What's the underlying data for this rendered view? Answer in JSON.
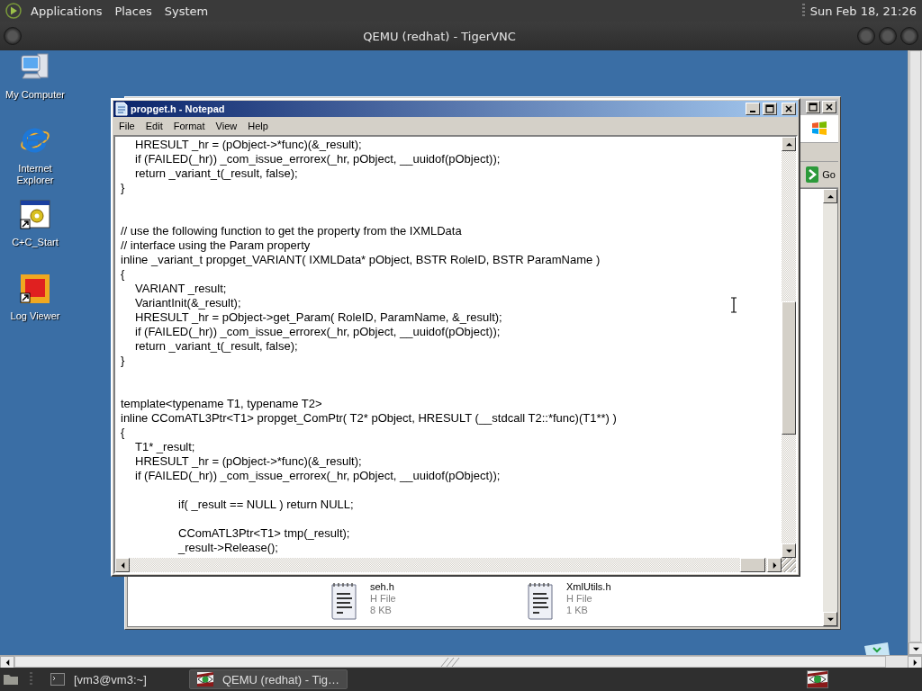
{
  "top_panel": {
    "menus": [
      "Applications",
      "Places",
      "System"
    ],
    "clock": "Sun Feb 18, 21:26"
  },
  "vnc_window": {
    "title": "QEMU (redhat) - TigerVNC"
  },
  "desktop_icons": [
    {
      "label": "My Computer",
      "kind": "computer"
    },
    {
      "label": "Internet Explorer",
      "kind": "browser"
    },
    {
      "label": "C+C_Start",
      "kind": "program"
    },
    {
      "label": "Log Viewer",
      "kind": "viewer"
    }
  ],
  "explorer_window": {
    "go_button": "Go",
    "files": [
      {
        "name": "seh.h",
        "type": "H File",
        "size": "8 KB"
      },
      {
        "name": "XmlUtils.h",
        "type": "H File",
        "size": "1 KB"
      }
    ]
  },
  "notepad": {
    "title": "propget.h - Notepad",
    "menu": [
      "File",
      "Edit",
      "Format",
      "View",
      "Help"
    ],
    "lines": [
      {
        "kind": "code",
        "text": "\tHRESULT _hr = (pObject->*func)(&_result);"
      },
      {
        "kind": "code",
        "text": "\tif (FAILED(_hr)) _com_issue_errorex(_hr, pObject, __uuidof(pObject));"
      },
      {
        "kind": "code",
        "text": "\treturn _variant_t(_result, false);"
      },
      {
        "kind": "code",
        "text": "}"
      },
      {
        "kind": "blank"
      },
      {
        "kind": "blank"
      },
      {
        "kind": "code",
        "text": "// use the following function to get the property from the IXMLData"
      },
      {
        "kind": "code",
        "text": "// interface using the Param property"
      },
      {
        "kind": "code",
        "text": "inline _variant_t propget_VARIANT( IXMLData* pObject, BSTR RoleID, BSTR ParamName )"
      },
      {
        "kind": "code",
        "text": "{"
      },
      {
        "kind": "code",
        "text": "\tVARIANT _result;"
      },
      {
        "kind": "code",
        "text": "\tVariantInit(&_result);"
      },
      {
        "kind": "code",
        "text": "\tHRESULT _hr = pObject->get_Param( RoleID, ParamName, &_result);"
      },
      {
        "kind": "code",
        "text": "\tif (FAILED(_hr)) _com_issue_errorex(_hr, pObject, __uuidof(pObject));"
      },
      {
        "kind": "code",
        "text": "\treturn _variant_t(_result, false);"
      },
      {
        "kind": "code",
        "text": "}"
      },
      {
        "kind": "blank"
      },
      {
        "kind": "blank"
      },
      {
        "kind": "code",
        "text": "template<typename T1, typename T2>"
      },
      {
        "kind": "code",
        "text": "inline CComATL3Ptr<T1> propget_ComPtr( T2* pObject, HRESULT (__stdcall T2::*func)(T1**) )"
      },
      {
        "kind": "code",
        "text": "{"
      },
      {
        "kind": "code",
        "text": "\tT1* _result;"
      },
      {
        "kind": "code",
        "text": "\tHRESULT _hr = (pObject->*func)(&_result);"
      },
      {
        "kind": "code",
        "text": "\tif (FAILED(_hr)) _com_issue_errorex(_hr, pObject, __uuidof(pObject));"
      },
      {
        "kind": "blank"
      },
      {
        "kind": "code",
        "text": "\t\t\t\tif( _result == NULL ) return NULL;"
      },
      {
        "kind": "blank"
      },
      {
        "kind": "code",
        "text": "\t\t\t\tCComATL3Ptr<T1> tmp(_result);"
      },
      {
        "kind": "code",
        "text": "\t\t\t\t_result->Release();"
      }
    ]
  },
  "taskbar": {
    "tasks": [
      {
        "label": "[vm3@vm3:~]",
        "kind": "terminal",
        "selected": false
      },
      {
        "label": "QEMU (redhat) - Tig…",
        "kind": "vnc",
        "selected": true
      }
    ]
  }
}
